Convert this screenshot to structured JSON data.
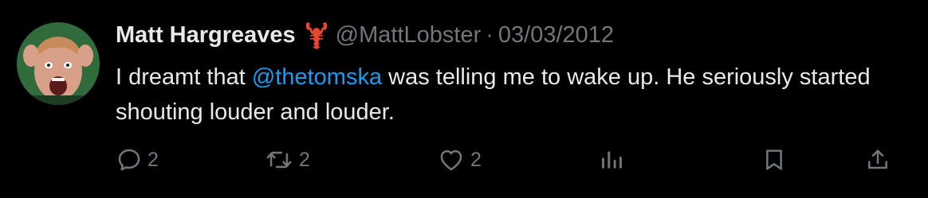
{
  "user": {
    "display_name": "Matt Hargreaves",
    "emoji": "lobster",
    "handle": "@MattLobster",
    "separator": "·",
    "date": "03/03/2012",
    "avatar_bg": "#2f6b3b"
  },
  "tweet": {
    "text_before": "I dreamt that ",
    "mention": "@thetomska",
    "text_after": " was telling me to wake up. He seriously started shouting louder and louder."
  },
  "actions": {
    "reply_count": "2",
    "retweet_count": "2",
    "like_count": "2"
  },
  "colors": {
    "background": "#000000",
    "text": "#e7e9ea",
    "muted": "#71767b",
    "link": "#1d9bf0"
  },
  "icons": [
    "reply-icon",
    "retweet-icon",
    "like-icon",
    "views-icon",
    "bookmark-icon",
    "share-icon",
    "lobster-icon"
  ]
}
